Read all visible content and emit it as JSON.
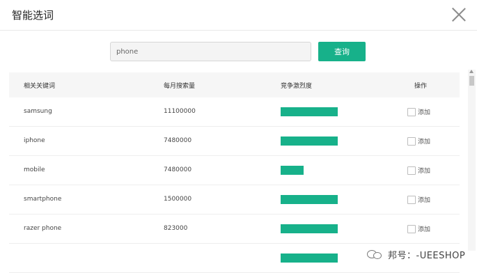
{
  "modal": {
    "title": "智能选词"
  },
  "search": {
    "value": "phone",
    "button_label": "查询"
  },
  "table": {
    "headers": [
      "相关关键词",
      "每月搜索量",
      "竞争激烈度",
      "操作"
    ],
    "rows": [
      {
        "keyword": "samsung",
        "volume": "11100000",
        "competition": 1.0,
        "action": "添加"
      },
      {
        "keyword": "iphone",
        "volume": "7480000",
        "competition": 1.0,
        "action": "添加"
      },
      {
        "keyword": "mobile",
        "volume": "7480000",
        "competition": 0.4,
        "action": "添加"
      },
      {
        "keyword": "smartphone",
        "volume": "1500000",
        "competition": 1.0,
        "action": "添加"
      },
      {
        "keyword": "razer phone",
        "volume": "823000",
        "competition": 1.0,
        "action": "添加"
      },
      {
        "keyword": "",
        "volume": "",
        "competition": 1.0,
        "action": ""
      }
    ]
  },
  "watermark": {
    "text": "邦号：-UEESHOP"
  },
  "colors": {
    "accent": "#17b18a"
  }
}
